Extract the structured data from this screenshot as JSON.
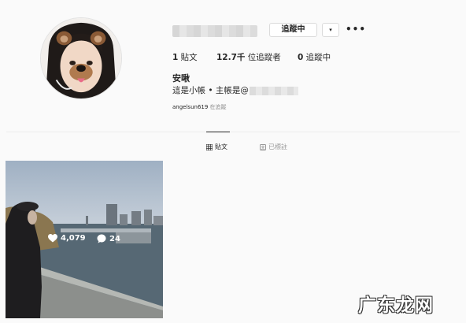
{
  "profile": {
    "follow_button_label": "追蹤中",
    "dropdown_icon": "▾",
    "more_icon": "•••",
    "full_name": "安啾",
    "bio": "這是小帳 • 主帳是@",
    "tagged_by_user": "angelsun619",
    "tagged_by_suffix": " 在追蹤"
  },
  "stats": {
    "posts_count": "1",
    "posts_label": " 貼文",
    "followers_count": "12.7千",
    "followers_label": " 位追蹤者",
    "following_count": "0",
    "following_label": " 追蹤中"
  },
  "tabs": {
    "posts": "貼文",
    "tagged": "已標註"
  },
  "post": {
    "likes": "4,079",
    "comments": "24"
  },
  "watermark": {
    "text": "广东龙网"
  },
  "icons": {
    "dropdown": "chevron-down-icon",
    "more": "ellipsis-icon",
    "posts_tab": "grid-icon",
    "tagged_tab": "tag-icon",
    "likes": "heart-icon",
    "comments": "comment-icon"
  }
}
